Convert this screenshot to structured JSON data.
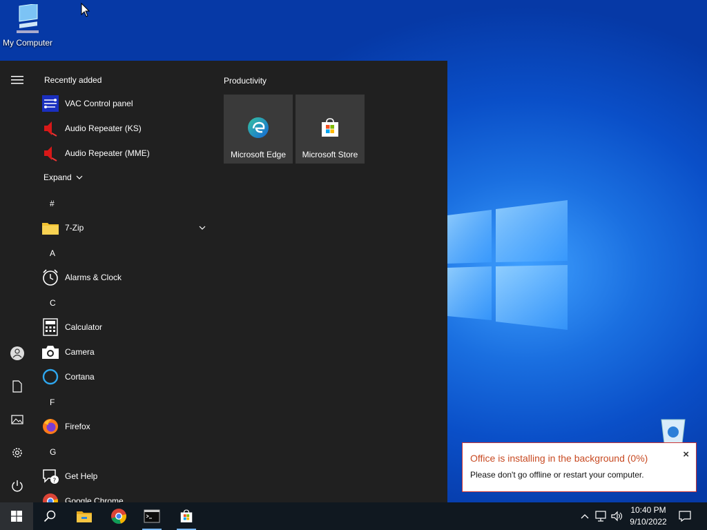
{
  "desktop": {
    "icons": [
      {
        "label": "My Computer",
        "icon": "computer-icon"
      },
      {
        "label": "",
        "icon": "recycle-bin-icon"
      }
    ]
  },
  "start_menu": {
    "recently_added_label": "Recently added",
    "recent_items": [
      {
        "label": "VAC Control panel",
        "icon": "vac-control-icon"
      },
      {
        "label": "Audio Repeater (KS)",
        "icon": "audio-repeater-icon"
      },
      {
        "label": "Audio Repeater (MME)",
        "icon": "audio-repeater-icon"
      }
    ],
    "expand_label": "Expand",
    "groups": [
      {
        "letter": "#",
        "items": [
          {
            "label": "7-Zip",
            "icon": "folder-icon",
            "expandable": true
          }
        ]
      },
      {
        "letter": "A",
        "items": [
          {
            "label": "Alarms & Clock",
            "icon": "alarm-clock-icon"
          }
        ]
      },
      {
        "letter": "C",
        "items": [
          {
            "label": "Calculator",
            "icon": "calculator-icon"
          },
          {
            "label": "Camera",
            "icon": "camera-icon"
          },
          {
            "label": "Cortana",
            "icon": "cortana-icon"
          }
        ]
      },
      {
        "letter": "F",
        "items": [
          {
            "label": "Firefox",
            "icon": "firefox-icon"
          }
        ]
      },
      {
        "letter": "G",
        "items": [
          {
            "label": "Get Help",
            "icon": "get-help-icon"
          },
          {
            "label": "Google Chrome",
            "icon": "chrome-icon"
          }
        ]
      }
    ],
    "rail_icons": [
      "hamburger-menu-icon",
      "user-icon",
      "documents-icon",
      "pictures-icon",
      "settings-icon",
      "power-icon"
    ],
    "tiles_group_label": "Productivity",
    "tiles": [
      {
        "label": "Microsoft Edge",
        "icon": "edge-icon"
      },
      {
        "label": "Microsoft Store",
        "icon": "store-icon"
      }
    ]
  },
  "taskbar": {
    "pinned": [
      "windows-start-icon",
      "search-icon",
      "file-explorer-icon",
      "chrome-icon",
      "cmd-icon",
      "store-icon"
    ],
    "tray": [
      "chevron-up-icon",
      "network-icon",
      "volume-icon"
    ],
    "time": "10:40 PM",
    "date": "9/10/2022"
  },
  "notification": {
    "title": "Office is installing in the background (0%)",
    "body": "Please don't go offline or restart your computer.",
    "close": "×"
  },
  "colors": {
    "accent": "#0a5fd6",
    "start_bg": "#202020",
    "tile_bg": "#3a3a3a",
    "toast_title": "#c84a22"
  }
}
